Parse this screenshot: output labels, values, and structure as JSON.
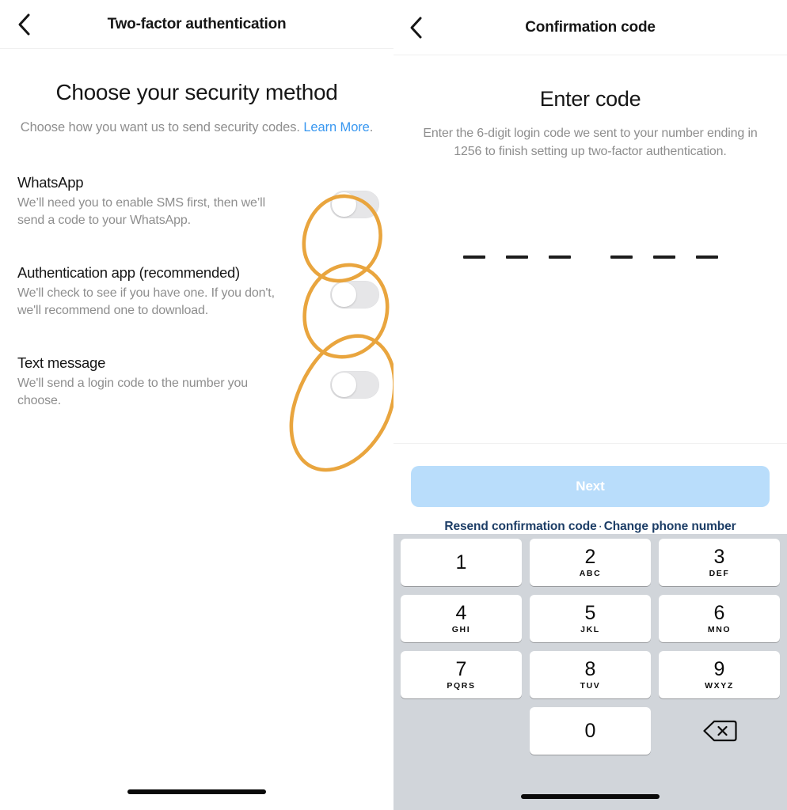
{
  "left_panel": {
    "nav": {
      "title": "Two-factor authentication",
      "back_icon": "chevron-left-icon"
    },
    "heading": "Choose your security method",
    "subtext": "Choose how you want us to send security codes.",
    "learn_more": "Learn More",
    "subtext_period": ".",
    "options": [
      {
        "title": "WhatsApp",
        "description": "We’ll need you to enable SMS first, then we’ll send a code to your WhatsApp.",
        "toggle_state": "off"
      },
      {
        "title": "Authentication app (recommended)",
        "description": "We'll check to see if you have one. If you don't, we'll recommend one to download.",
        "toggle_state": "off"
      },
      {
        "title": "Text message",
        "description": "We'll send a login code to the number you choose.",
        "toggle_state": "off"
      }
    ]
  },
  "right_panel": {
    "nav": {
      "title": "Confirmation code",
      "back_icon": "chevron-left-icon"
    },
    "heading": "Enter code",
    "subtext": "Enter the 6-digit login code we sent to your number ending in 1256 to finish setting up two-factor authentication.",
    "code_digits": [
      "",
      "",
      "",
      "",
      "",
      ""
    ],
    "code_length": 6,
    "next_label": "Next",
    "next_state": "disabled",
    "resend_link": "Resend confirmation code",
    "link_separator": "·",
    "change_number_link": "Change phone number",
    "keypad": {
      "keys": [
        {
          "num": "1",
          "letters": ""
        },
        {
          "num": "2",
          "letters": "ABC"
        },
        {
          "num": "3",
          "letters": "DEF"
        },
        {
          "num": "4",
          "letters": "GHI"
        },
        {
          "num": "5",
          "letters": "JKL"
        },
        {
          "num": "6",
          "letters": "MNO"
        },
        {
          "num": "7",
          "letters": "PQRS"
        },
        {
          "num": "8",
          "letters": "TUV"
        },
        {
          "num": "9",
          "letters": "WXYZ"
        },
        {
          "num": "0",
          "letters": ""
        }
      ],
      "delete_icon": "backspace-delete-icon"
    }
  },
  "annotation": {
    "type": "hand-drawn-ellipses",
    "count": 3,
    "color": "#e9a53e",
    "targets": "security-method-toggles"
  },
  "colors": {
    "link_blue": "#3897f0",
    "next_button_bg": "#b9ddfb",
    "link_navy": "#1c3d66",
    "keypad_bg": "#d1d5da",
    "toggle_off": "#e6e6e8",
    "annotation_orange": "#e9a53e",
    "text_primary": "#161616",
    "text_secondary": "#8e8e8e"
  }
}
